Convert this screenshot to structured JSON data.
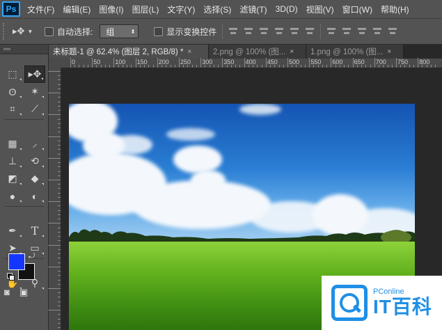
{
  "app": {
    "logo": "Ps"
  },
  "menu": [
    "文件(F)",
    "编辑(E)",
    "图像(I)",
    "图层(L)",
    "文字(Y)",
    "选择(S)",
    "滤镜(T)",
    "3D(D)",
    "视图(V)",
    "窗口(W)",
    "帮助(H)"
  ],
  "options": {
    "auto_select_label": "自动选择:",
    "auto_select_value": "组",
    "show_transform_label": "显示变换控件"
  },
  "tabs": [
    {
      "label": "未标题-1 @ 62.4% (图层 2, RGB/8) *",
      "close": "×"
    },
    {
      "label": "2.png @ 100% (图...",
      "close": "×"
    },
    {
      "label": "1.png @ 100% (图...",
      "close": "×"
    }
  ],
  "ruler": {
    "top_ticks": [
      "0",
      "50",
      "100",
      "150",
      "200",
      "250",
      "300",
      "350",
      "400",
      "450",
      "500",
      "550",
      "600",
      "650",
      "700",
      "750",
      "800"
    ]
  },
  "colors": {
    "foreground": "#1437ff",
    "background": "#111111"
  },
  "watermark": {
    "small": "PConline",
    "big": "IT百科"
  }
}
